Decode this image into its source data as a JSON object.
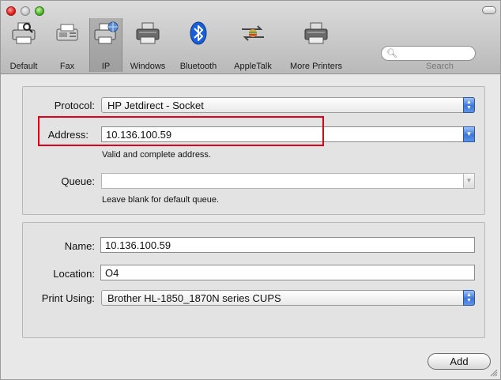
{
  "toolbar": {
    "items": [
      {
        "label": "Default",
        "icon": "printer-default-icon"
      },
      {
        "label": "Fax",
        "icon": "fax-icon"
      },
      {
        "label": "IP",
        "icon": "ip-printer-icon",
        "selected": true
      },
      {
        "label": "Windows",
        "icon": "windows-printer-icon"
      },
      {
        "label": "Bluetooth",
        "icon": "bluetooth-icon"
      },
      {
        "label": "AppleTalk",
        "icon": "appletalk-icon"
      },
      {
        "label": "More Printers",
        "icon": "more-printers-icon"
      }
    ],
    "search_label": "Search",
    "search_value": ""
  },
  "connection": {
    "protocol_label": "Protocol:",
    "protocol_value": "HP Jetdirect - Socket",
    "address_label": "Address:",
    "address_value": "10.136.100.59",
    "address_hint": "Valid and complete address.",
    "queue_label": "Queue:",
    "queue_value": "",
    "queue_hint": "Leave blank for default queue."
  },
  "printer": {
    "name_label": "Name:",
    "name_value": "10.136.100.59",
    "location_label": "Location:",
    "location_value": "O4",
    "print_using_label": "Print Using:",
    "print_using_value": "Brother HL-1850_1870N series CUPS"
  },
  "actions": {
    "add_label": "Add"
  },
  "colors": {
    "highlight": "#e3001b",
    "accent": "#3a77d8"
  }
}
